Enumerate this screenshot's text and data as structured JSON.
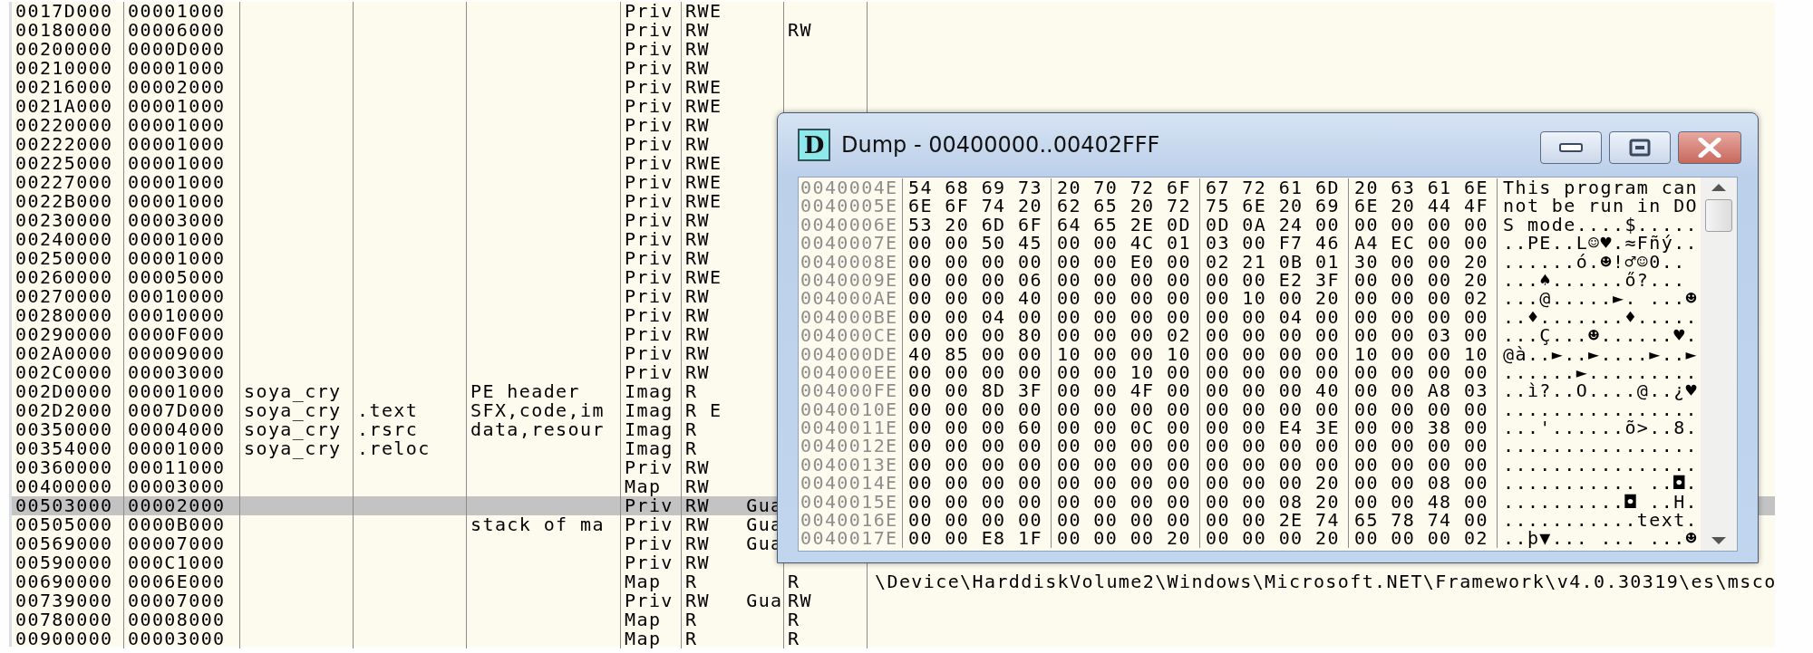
{
  "memory_map": {
    "rows": [
      {
        "address": "0017D000",
        "size": "00001000",
        "type": "Priv",
        "access": "RWE",
        "selected": false
      },
      {
        "address": "00180000",
        "size": "00006000",
        "type": "Priv",
        "access": "RW",
        "initial": "RW",
        "selected": false
      },
      {
        "address": "00200000",
        "size": "0000D000",
        "type": "Priv",
        "access": "RW",
        "selected": false
      },
      {
        "address": "00210000",
        "size": "00001000",
        "type": "Priv",
        "access": "RW",
        "selected": false
      },
      {
        "address": "00216000",
        "size": "00002000",
        "type": "Priv",
        "access": "RWE",
        "selected": false
      },
      {
        "address": "0021A000",
        "size": "00001000",
        "type": "Priv",
        "access": "RWE",
        "selected": false
      },
      {
        "address": "00220000",
        "size": "00001000",
        "type": "Priv",
        "access": "RW",
        "selected": false
      },
      {
        "address": "00222000",
        "size": "00001000",
        "type": "Priv",
        "access": "RW",
        "selected": false
      },
      {
        "address": "00225000",
        "size": "00001000",
        "type": "Priv",
        "access": "RWE",
        "selected": false
      },
      {
        "address": "00227000",
        "size": "00001000",
        "type": "Priv",
        "access": "RWE",
        "selected": false
      },
      {
        "address": "0022B000",
        "size": "00001000",
        "type": "Priv",
        "access": "RWE",
        "selected": false
      },
      {
        "address": "00230000",
        "size": "00003000",
        "type": "Priv",
        "access": "RW",
        "selected": false
      },
      {
        "address": "00240000",
        "size": "00001000",
        "type": "Priv",
        "access": "RW",
        "selected": false
      },
      {
        "address": "00250000",
        "size": "00001000",
        "type": "Priv",
        "access": "RW",
        "selected": false
      },
      {
        "address": "00260000",
        "size": "00005000",
        "type": "Priv",
        "access": "RWE",
        "selected": false
      },
      {
        "address": "00270000",
        "size": "00010000",
        "type": "Priv",
        "access": "RW",
        "selected": false
      },
      {
        "address": "00280000",
        "size": "00010000",
        "type": "Priv",
        "access": "RW",
        "selected": false
      },
      {
        "address": "00290000",
        "size": "0000F000",
        "type": "Priv",
        "access": "RW",
        "selected": false
      },
      {
        "address": "002A0000",
        "size": "00009000",
        "type": "Priv",
        "access": "RW",
        "selected": false
      },
      {
        "address": "002C0000",
        "size": "00003000",
        "type": "Priv",
        "access": "RW",
        "selected": false
      },
      {
        "address": "002D0000",
        "size": "00001000",
        "owner": "soya_cry",
        "contains": "PE header",
        "type": "Imag",
        "access": "R",
        "selected": false
      },
      {
        "address": "002D2000",
        "size": "0007D000",
        "owner": "soya_cry",
        "section": ".text",
        "contains": "SFX,code,im",
        "type": "Imag",
        "access": "R E",
        "selected": false
      },
      {
        "address": "00350000",
        "size": "00004000",
        "owner": "soya_cry",
        "section": ".rsrc",
        "contains": "data,resour",
        "type": "Imag",
        "access": "R",
        "selected": false
      },
      {
        "address": "00354000",
        "size": "00001000",
        "owner": "soya_cry",
        "section": ".reloc",
        "type": "Imag",
        "access": "R",
        "selected": false
      },
      {
        "address": "00360000",
        "size": "00011000",
        "type": "Priv",
        "access": "RW",
        "selected": false
      },
      {
        "address": "00400000",
        "size": "00003000",
        "type": "Map",
        "access": "RW",
        "selected": false
      },
      {
        "address": "00503000",
        "size": "00002000",
        "type": "Priv",
        "access": "RW   Gua",
        "selected": true
      },
      {
        "address": "00505000",
        "size": "0000B000",
        "contains": "stack of ma",
        "type": "Priv",
        "access": "RW   Gua",
        "selected": false
      },
      {
        "address": "00569000",
        "size": "00007000",
        "type": "Priv",
        "access": "RW   Gua",
        "selected": false
      },
      {
        "address": "00590000",
        "size": "000C1000",
        "type": "Priv",
        "access": "RW",
        "selected": false
      },
      {
        "address": "00690000",
        "size": "0006E000",
        "type": "Map",
        "access": "R",
        "initial": "R",
        "mapped_as": "\\Device\\HarddiskVolume2\\Windows\\Microsoft.NET\\Framework\\v4.0.30319\\es\\msco",
        "selected": false
      },
      {
        "address": "00739000",
        "size": "00007000",
        "type": "Priv",
        "access": "RW   Gua",
        "initial": "RW",
        "selected": false
      },
      {
        "address": "00780000",
        "size": "00008000",
        "type": "Map",
        "access": "R",
        "initial": "R",
        "selected": false
      },
      {
        "address": "00900000",
        "size": "00003000",
        "type": "Map",
        "access": "R",
        "initial": "R",
        "selected": false
      }
    ]
  },
  "dump_window": {
    "icon_letter": "D",
    "title": "Dump - 00400000..00402FFF",
    "rows": [
      {
        "address": "0040004E",
        "hex": [
          "54 68 69 73",
          "20 70 72 6F",
          "67 72 61 6D",
          "20 63 61 6E"
        ],
        "ascii": "This program can"
      },
      {
        "address": "0040005E",
        "hex": [
          "6E 6F 74 20",
          "62 65 20 72",
          "75 6E 20 69",
          "6E 20 44 4F"
        ],
        "ascii": "not be run in DO"
      },
      {
        "address": "0040006E",
        "hex": [
          "53 20 6D 6F",
          "64 65 2E 0D",
          "0D 0A 24 00",
          "00 00 00 00"
        ],
        "ascii": "S mode....$....."
      },
      {
        "address": "0040007E",
        "hex": [
          "00 00 50 45",
          "00 00 4C 01",
          "03 00 F7 46",
          "A4 EC 00 00"
        ],
        "ascii": "..PE..L☺♥.≈Fñý.."
      },
      {
        "address": "0040008E",
        "hex": [
          "00 00 00 00",
          "00 00 E0 00",
          "02 21 0B 01",
          "30 00 00 20"
        ],
        "ascii": "......ó.☻!♂☺0.."
      },
      {
        "address": "0040009E",
        "hex": [
          "00 00 00 06",
          "00 00 00 00",
          "00 00 E2 3F",
          "00 00 00 20"
        ],
        "ascii": "...♠......ő?..."
      },
      {
        "address": "004000AE",
        "hex": [
          "00 00 00 40",
          "00 00 00 00",
          "00 10 00 20",
          "00 00 00 02"
        ],
        "ascii": "...@.....►. ...☻"
      },
      {
        "address": "004000BE",
        "hex": [
          "00 00 04 00",
          "00 00 00 00",
          "00 00 04 00",
          "00 00 00 00"
        ],
        "ascii": "..♦.......♦....."
      },
      {
        "address": "004000CE",
        "hex": [
          "00 00 00 80",
          "00 00 00 02",
          "00 00 00 00",
          "00 00 03 00"
        ],
        "ascii": "...Ç...☻......♥."
      },
      {
        "address": "004000DE",
        "hex": [
          "40 85 00 00",
          "10 00 00 10",
          "00 00 00 00",
          "10 00 00 10"
        ],
        "ascii": "@à..►..►....►..►"
      },
      {
        "address": "004000EE",
        "hex": [
          "00 00 00 00",
          "00 00 10 00",
          "00 00 00 00",
          "00 00 00 00"
        ],
        "ascii": "......►........."
      },
      {
        "address": "004000FE",
        "hex": [
          "00 00 8D 3F",
          "00 00 4F 00",
          "00 00 00 40",
          "00 00 A8 03"
        ],
        "ascii": "..ì?..O....@..¿♥"
      },
      {
        "address": "0040010E",
        "hex": [
          "00 00 00 00",
          "00 00 00 00",
          "00 00 00 00",
          "00 00 00 00"
        ],
        "ascii": "................"
      },
      {
        "address": "0040011E",
        "hex": [
          "00 00 00 60",
          "00 00 0C 00",
          "00 00 E4 3E",
          "00 00 38 00"
        ],
        "ascii": "...'......õ>..8."
      },
      {
        "address": "0040012E",
        "hex": [
          "00 00 00 00",
          "00 00 00 00",
          "00 00 00 00",
          "00 00 00 00"
        ],
        "ascii": "................"
      },
      {
        "address": "0040013E",
        "hex": [
          "00 00 00 00",
          "00 00 00 00",
          "00 00 00 00",
          "00 00 00 00"
        ],
        "ascii": "................"
      },
      {
        "address": "0040014E",
        "hex": [
          "00 00 00 00",
          "00 00 00 00",
          "00 00 00 20",
          "00 00 08 00"
        ],
        "ascii": "........... ..◘."
      },
      {
        "address": "0040015E",
        "hex": [
          "00 00 00 00",
          "00 00 00 00",
          "00 00 08 20",
          "00 00 48 00"
        ],
        "ascii": "..........◘ ..H."
      },
      {
        "address": "0040016E",
        "hex": [
          "00 00 00 00",
          "00 00 00 00",
          "00 00 2E 74",
          "65 78 74 00"
        ],
        "ascii": "...........text."
      },
      {
        "address": "0040017E",
        "hex": [
          "00 00 E8 1F",
          "00 00 00 20",
          "00 00 00 20",
          "00 00 00 02"
        ],
        "ascii": "..þ▼... ... ...☻"
      }
    ]
  }
}
